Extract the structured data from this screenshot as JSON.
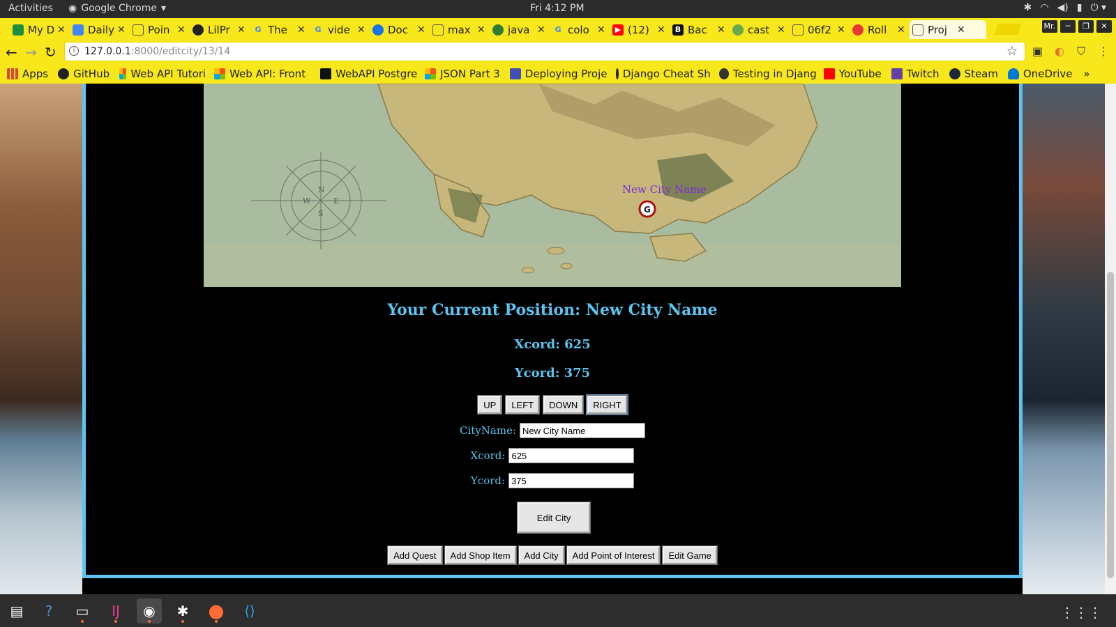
{
  "system_bar": {
    "activities": "Activities",
    "app_name": "Google Chrome",
    "clock": "Fri  4:12 PM",
    "user": "Mr."
  },
  "tabs": [
    {
      "label": "My D",
      "icon": "drive-icon",
      "color": "#1e8e3e"
    },
    {
      "label": "Daily",
      "icon": "docs-icon",
      "color": "#4285f4"
    },
    {
      "label": "Poin",
      "icon": "page-icon",
      "color": "#888888"
    },
    {
      "label": "LilPr",
      "icon": "github-icon",
      "color": "#222222"
    },
    {
      "label": "The",
      "icon": "google-icon",
      "color": "#4285f4"
    },
    {
      "label": "vide",
      "icon": "google-icon",
      "color": "#4285f4"
    },
    {
      "label": "Doc",
      "icon": "doc-icon",
      "color": "#1a73e8"
    },
    {
      "label": "max",
      "icon": "page-icon",
      "color": "#888888"
    },
    {
      "label": "java",
      "icon": "cloud-icon",
      "color": "#2e7d32"
    },
    {
      "label": "colo",
      "icon": "google-icon",
      "color": "#4285f4"
    },
    {
      "label": "(12)",
      "icon": "youtube-icon",
      "color": "#ff0000"
    },
    {
      "label": "Bac",
      "icon": "b-icon",
      "color": "#111111"
    },
    {
      "label": "cast",
      "icon": "leaf-icon",
      "color": "#6aa84f"
    },
    {
      "label": "06f2",
      "icon": "page-icon",
      "color": "#888888"
    },
    {
      "label": "Roll",
      "icon": "dice-icon",
      "color": "#e53935"
    },
    {
      "label": "Proj",
      "icon": "page-icon",
      "color": "#888888",
      "active": true
    }
  ],
  "address": {
    "host": "127.0.0.1",
    "rest": ":8000/editcity/13/14"
  },
  "bookmarks": [
    {
      "label": "Apps",
      "color": "#db4437"
    },
    {
      "label": "GitHub",
      "color": "#222222"
    },
    {
      "label": "Web API Tutori",
      "color": "#f25022"
    },
    {
      "label": "Web API: Front",
      "color": "#f25022"
    },
    {
      "label": "WebAPI Postgre",
      "color": "#111111"
    },
    {
      "label": "JSON Part 3",
      "color": "#f25022"
    },
    {
      "label": "Deploying Proje",
      "color": "#3f51b5"
    },
    {
      "label": "Django Cheat Sh",
      "color": "#222222"
    },
    {
      "label": "Testing in Djang",
      "color": "#333333"
    },
    {
      "label": "YouTube",
      "color": "#ff0000"
    },
    {
      "label": "Twitch",
      "color": "#6441a5"
    },
    {
      "label": "Steam",
      "color": "#1b2838"
    },
    {
      "label": "OneDrive",
      "color": "#0078d4"
    }
  ],
  "map": {
    "marker_label": "New City Name",
    "marker_glyph": "G",
    "compass_n": "N",
    "compass_s": "S",
    "compass_e": "E",
    "compass_w": "W"
  },
  "position": {
    "title": "Your Current Position: New City Name",
    "xcord": "Xcord: 625",
    "ycord": "Ycord: 375"
  },
  "direction_buttons": {
    "up": "UP",
    "left": "LEFT",
    "down": "DOWN",
    "right": "RIGHT"
  },
  "form": {
    "city_label": "CityName:",
    "city_value": "New City Name",
    "x_label": "Xcord:",
    "x_value": "625",
    "y_label": "Ycord:",
    "y_value": "375",
    "submit": "Edit City"
  },
  "actions": {
    "add_quest": "Add Quest",
    "add_shop_item": "Add Shop Item",
    "add_city": "Add City",
    "add_poi": "Add Point of Interest",
    "edit_game": "Edit Game"
  },
  "colors": {
    "accent": "#5ec3ee",
    "chrome_theme": "#f7e71b",
    "marker_text": "#7b2bd6"
  }
}
